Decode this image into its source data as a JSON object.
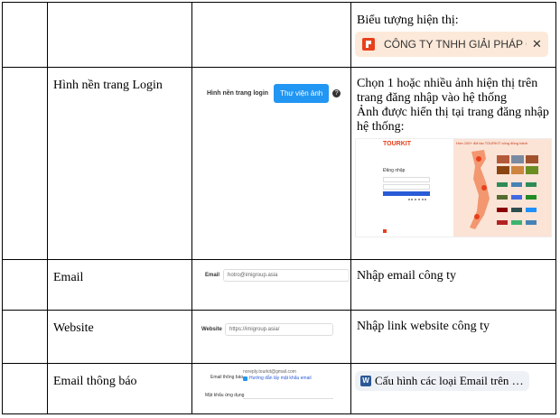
{
  "row1": {
    "desc": "Biểu tượng hiện thị:",
    "company_banner": "CÔNG TY TNHH GIẢI PHÁP CÔN",
    "close_glyph": "✕"
  },
  "row2": {
    "label": "Hình nền trang Login",
    "form_label": "Hình nền trang login",
    "button": "Thư viện ảnh",
    "help_glyph": "?",
    "desc": "Chọn 1 hoặc nhiều ảnh hiện thị trên trang đăng nhập vào hệ thống\nẢnh được hiển thị tại trang đăng nhập hệ thống:",
    "preview": {
      "logo": "TOURKIT",
      "login_title": "Đăng nhập",
      "headline": "Hơn 100+ đối tác TOURKIT công đồng hành"
    }
  },
  "row3": {
    "label": "Email",
    "form_label": "Email",
    "value": "hotro@imigroup.asia",
    "desc": "Nhập email công ty"
  },
  "row4": {
    "label": "Website",
    "form_label": "Website",
    "value": "https://imigroup.asia/",
    "desc": "Nhập link website công ty"
  },
  "row5": {
    "label": "Email thông báo",
    "form_label": "Email thông báo",
    "value": "noreply.tourkit@gmail.com",
    "guide_link": "Hướng dẫn lấy mật khẩu email",
    "pw_label": "Mật khẩu ứng dụng",
    "chip_icon": "W",
    "chip_text": "Cấu hình các loại Email trên …"
  },
  "colors": {
    "accent": "#2196f3",
    "brand_red": "#e8401c",
    "banner_bg": "#fde9d9"
  }
}
